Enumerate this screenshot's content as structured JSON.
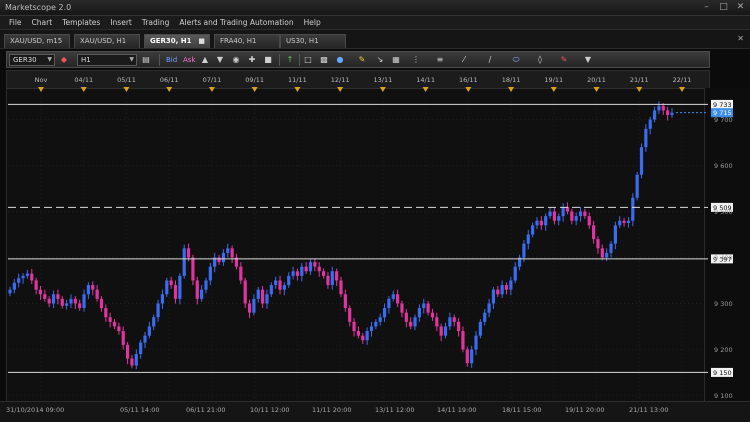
{
  "window": {
    "title": "Marketscope 2.0"
  },
  "menu": [
    "File",
    "Chart",
    "Templates",
    "Insert",
    "Trading",
    "Alerts and Trading Automation",
    "Help"
  ],
  "tabs": [
    {
      "label": "XAU/USD, m15",
      "active": false
    },
    {
      "label": "XAU/USD, H1",
      "active": false
    },
    {
      "label": "GER30, H1",
      "active": true
    },
    {
      "label": "FRA40, H1",
      "active": false
    },
    {
      "label": "US30, H1",
      "active": false
    }
  ],
  "toolbar": {
    "instrument": "GER30",
    "timeframe": "H1",
    "bid_label": "Bid",
    "ask_label": "Ask"
  },
  "icons": {
    "minimize": "minimize-icon",
    "maximize": "maximize-icon",
    "close": "close-icon"
  },
  "chart_data": {
    "type": "candlestick",
    "instrument": "GER30",
    "timeframe": "H1",
    "top_date_labels": [
      "Nov",
      "04/11",
      "05/11",
      "06/11",
      "07/11",
      "09/11",
      "11/11",
      "12/11",
      "13/11",
      "14/11",
      "16/11",
      "18/11",
      "19/11",
      "20/11",
      "21/11",
      "22/11"
    ],
    "bottom_date_labels": [
      "31/10/2014 09:00",
      "05/11 14:00",
      "06/11 21:00",
      "10/11 12:00",
      "11/11 20:00",
      "13/11 12:00",
      "14/11 19:00",
      "18/11 15:00",
      "19/11 20:00",
      "21/11 13:00"
    ],
    "price_ticks": [
      9700,
      9600,
      9500,
      9400,
      9300,
      9200,
      9100
    ],
    "y_range": [
      9090,
      9760
    ],
    "horizontal_lines": [
      {
        "price": 9733,
        "label": "9 733",
        "style": "solid"
      },
      {
        "price": 9509,
        "label": "9 509",
        "style": "dashed"
      },
      {
        "price": 9397,
        "label": "9 397",
        "style": "solid"
      },
      {
        "price": 9150,
        "label": "9 150",
        "style": "solid"
      }
    ],
    "current_price": {
      "price": 9715,
      "label": "9 715"
    },
    "colors": {
      "up": "#3a6cf0",
      "down": "#e0359f",
      "background": "#101010",
      "grid": "#1e1e1e",
      "line": "#d9d9d9",
      "current": "#3b8fe8"
    },
    "close_path": [
      9330,
      9345,
      9355,
      9360,
      9365,
      9350,
      9330,
      9320,
      9310,
      9300,
      9320,
      9310,
      9295,
      9300,
      9310,
      9300,
      9290,
      9320,
      9340,
      9330,
      9310,
      9290,
      9270,
      9260,
      9250,
      9240,
      9210,
      9180,
      9165,
      9190,
      9215,
      9230,
      9250,
      9270,
      9300,
      9320,
      9350,
      9340,
      9310,
      9360,
      9420,
      9400,
      9350,
      9310,
      9330,
      9350,
      9380,
      9400,
      9390,
      9410,
      9420,
      9400,
      9380,
      9350,
      9300,
      9280,
      9310,
      9330,
      9300,
      9320,
      9340,
      9350,
      9330,
      9340,
      9360,
      9370,
      9360,
      9380,
      9370,
      9390,
      9380,
      9370,
      9360,
      9340,
      9370,
      9350,
      9320,
      9290,
      9260,
      9240,
      9230,
      9220,
      9240,
      9250,
      9260,
      9270,
      9290,
      9310,
      9320,
      9300,
      9280,
      9260,
      9250,
      9270,
      9290,
      9300,
      9280,
      9270,
      9250,
      9230,
      9250,
      9270,
      9260,
      9240,
      9200,
      9170,
      9200,
      9230,
      9260,
      9280,
      9300,
      9330,
      9320,
      9340,
      9330,
      9350,
      9380,
      9400,
      9430,
      9450,
      9470,
      9480,
      9470,
      9490,
      9500,
      9480,
      9490,
      9510,
      9500,
      9480,
      9490,
      9500,
      9490,
      9470,
      9440,
      9420,
      9400,
      9410,
      9430,
      9470,
      9480,
      9475,
      9480,
      9530,
      9580,
      9640,
      9680,
      9700,
      9720,
      9730,
      9720,
      9710,
      9715
    ]
  },
  "status": {
    "last_price": "9 715"
  }
}
